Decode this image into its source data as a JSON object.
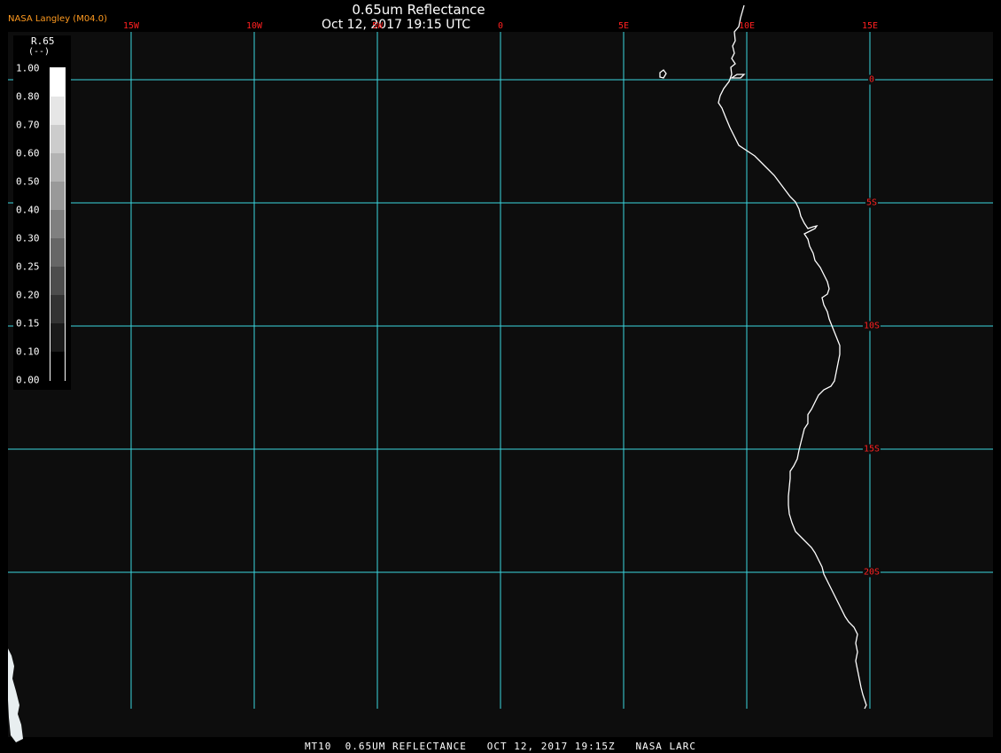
{
  "header": {
    "producer": "NASA Langley (M04.0)",
    "title": "0.65um Reflectance",
    "subtitle": "Oct 12, 2017 19:15 UTC"
  },
  "map": {
    "longitude_labels": [
      {
        "text": "15W",
        "lon": -15
      },
      {
        "text": "10W",
        "lon": -10
      },
      {
        "text": "5W",
        "lon": -5
      },
      {
        "text": "0",
        "lon": 0
      },
      {
        "text": "5E",
        "lon": 5
      },
      {
        "text": "10E",
        "lon": 10
      },
      {
        "text": "15E",
        "lon": 15
      }
    ],
    "latitude_labels": [
      {
        "text": "0",
        "lat": 0
      },
      {
        "text": "5S",
        "lat": -5
      },
      {
        "text": "10S",
        "lat": -10
      },
      {
        "text": "15S",
        "lat": -15
      },
      {
        "text": "20S",
        "lat": -20
      }
    ],
    "colors": {
      "background": "#0d0d0d",
      "gridlines": "#3ad6e0",
      "coastline": "#ffffff",
      "grid_labels": "#ff2020",
      "producer_label": "#ff9a1f"
    }
  },
  "legend": {
    "variable": "R.65",
    "unit": "(--)",
    "ticks": [
      "1.00",
      "0.80",
      "0.70",
      "0.60",
      "0.50",
      "0.40",
      "0.30",
      "0.25",
      "0.20",
      "0.15",
      "0.10",
      "0.00"
    ]
  },
  "footer": {
    "text": "MT10  0.65UM REFLECTANCE   OCT 12, 2017 19:15Z   NASA LARC"
  }
}
